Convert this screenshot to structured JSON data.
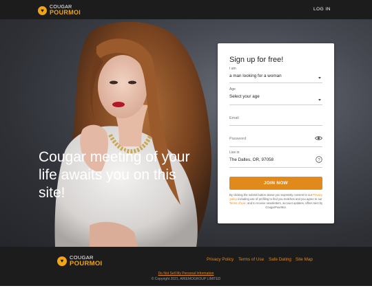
{
  "header": {
    "logo_top": "COUGAR",
    "logo_bottom": "POURMOI",
    "login_label": "LOG IN"
  },
  "hero": {
    "headline": "Cougar meeting of your life awaits you on this site!"
  },
  "signup": {
    "title": "Sign up for free!",
    "iam_label": "I am",
    "iam_value": "a man looking for a woman",
    "age_label": "Age",
    "age_value": "Select your age",
    "email_placeholder": "Email",
    "password_placeholder": "Password",
    "location_label": "Live in",
    "location_value": "The Dalles, OR, 97058",
    "join_label": "JOIN NOW",
    "consent": {
      "part1": "By clicking the submit button above you expressly consent to our ",
      "privacy_link": "Privacy policy",
      "part2": " including use of profiling to find you matches and you agree to our ",
      "terms_link": "Terms of use",
      "part3": ", and to receive newsletters, account updates, offers sent by CougarPourMoi."
    }
  },
  "footer": {
    "logo_top": "COUGAR",
    "logo_bottom": "POURMOI",
    "links": [
      "Privacy Policy",
      "Terms of Use",
      "Safe Dating",
      "Site Map"
    ],
    "do_not_sell": "Do Not Sell My Personal Information",
    "copyright": "© Copyright 2021, ARIEMOGROUP LIMITED"
  },
  "colors": {
    "brand_orange": "#e18a1b",
    "logo_yellow": "#f0a418",
    "header_bg": "#1c1c1c"
  }
}
